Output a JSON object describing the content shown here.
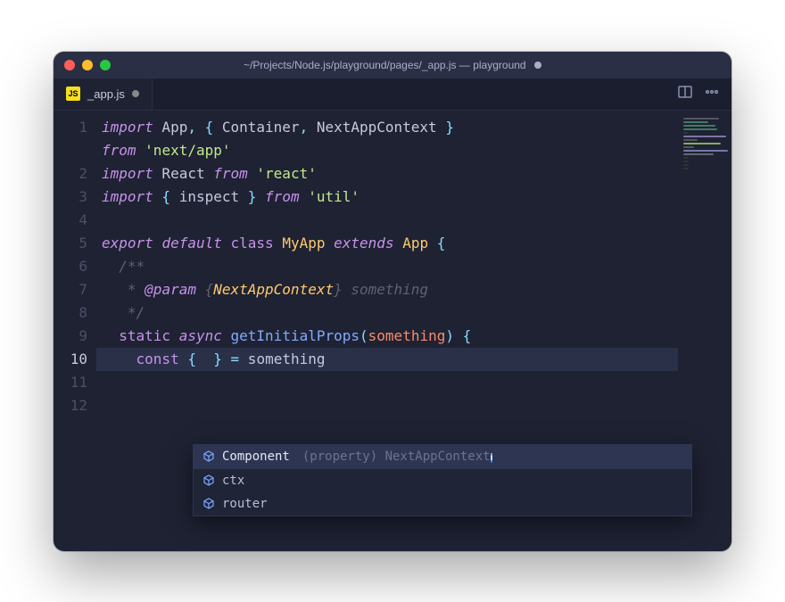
{
  "window": {
    "title": "~/Projects/Node.js/playground/pages/_app.js — playground",
    "modified": true
  },
  "tab": {
    "icon_label": "JS",
    "filename": "_app.js",
    "modified": true
  },
  "gutter": {
    "lines": [
      "1",
      "2",
      "3",
      "4",
      "5",
      "6",
      "7",
      "8",
      "9",
      "10",
      "11",
      "12"
    ],
    "active_line": 10
  },
  "code": {
    "tokens": [
      [
        [
          "kw",
          "import"
        ],
        [
          "txt",
          " App"
        ],
        [
          "punc",
          ", { "
        ],
        [
          "txt",
          "Container"
        ],
        [
          "punc",
          ", "
        ],
        [
          "txt",
          "NextAppContext"
        ],
        [
          "punc",
          " } "
        ]
      ],
      [
        [
          "kw",
          "from"
        ],
        [
          "txt",
          " "
        ],
        [
          "str",
          "'next/app'"
        ]
      ],
      [
        [
          "kw",
          "import"
        ],
        [
          "txt",
          " React "
        ],
        [
          "kw",
          "from"
        ],
        [
          "txt",
          " "
        ],
        [
          "str",
          "'react'"
        ]
      ],
      [
        [
          "kw",
          "import"
        ],
        [
          "punc",
          " { "
        ],
        [
          "txt",
          "inspect"
        ],
        [
          "punc",
          " } "
        ],
        [
          "kw",
          "from"
        ],
        [
          "txt",
          " "
        ],
        [
          "str",
          "'util'"
        ]
      ],
      [],
      [
        [
          "kw",
          "export"
        ],
        [
          "txt",
          " "
        ],
        [
          "kw",
          "default"
        ],
        [
          "txt",
          " "
        ],
        [
          "static",
          "class"
        ],
        [
          "txt",
          " "
        ],
        [
          "cls",
          "MyApp"
        ],
        [
          "txt",
          " "
        ],
        [
          "kw",
          "extends"
        ],
        [
          "txt",
          " "
        ],
        [
          "cls",
          "App"
        ],
        [
          "txt",
          " "
        ],
        [
          "punc",
          "{"
        ]
      ],
      [
        [
          "cmt",
          "  /**"
        ]
      ],
      [
        [
          "cmt",
          "   * "
        ],
        [
          "kw",
          "@param"
        ],
        [
          "cmt",
          " {"
        ],
        [
          "type",
          "NextAppContext"
        ],
        [
          "cmt",
          "} "
        ],
        [
          "cmt",
          "something"
        ]
      ],
      [
        [
          "cmt",
          "   */"
        ]
      ],
      [
        [
          "txt",
          "  "
        ],
        [
          "static",
          "static"
        ],
        [
          "txt",
          " "
        ],
        [
          "kw",
          "async"
        ],
        [
          "txt",
          " "
        ],
        [
          "fn",
          "getInitialProps"
        ],
        [
          "punc",
          "("
        ],
        [
          "param",
          "something"
        ],
        [
          "punc",
          ") {"
        ]
      ],
      [
        [
          "txt",
          "    "
        ],
        [
          "static",
          "const"
        ],
        [
          "txt",
          " "
        ],
        [
          "punc",
          "{"
        ],
        [
          "txt",
          "  "
        ],
        [
          "punc",
          "}"
        ],
        [
          "txt",
          " "
        ],
        [
          "punc",
          "="
        ],
        [
          "txt",
          " something"
        ]
      ],
      [],
      []
    ],
    "wrapped_first_line": true,
    "active_index": 10
  },
  "autocomplete": {
    "items": [
      {
        "label": "Component",
        "detail": "(property) NextAppContext<Record<…",
        "selected": true,
        "info": true
      },
      {
        "label": "ctx",
        "detail": "",
        "selected": false,
        "info": false
      },
      {
        "label": "router",
        "detail": "",
        "selected": false,
        "info": false
      }
    ]
  },
  "actions": {
    "split_tooltip": "Split Editor",
    "more_tooltip": "More Actions"
  }
}
